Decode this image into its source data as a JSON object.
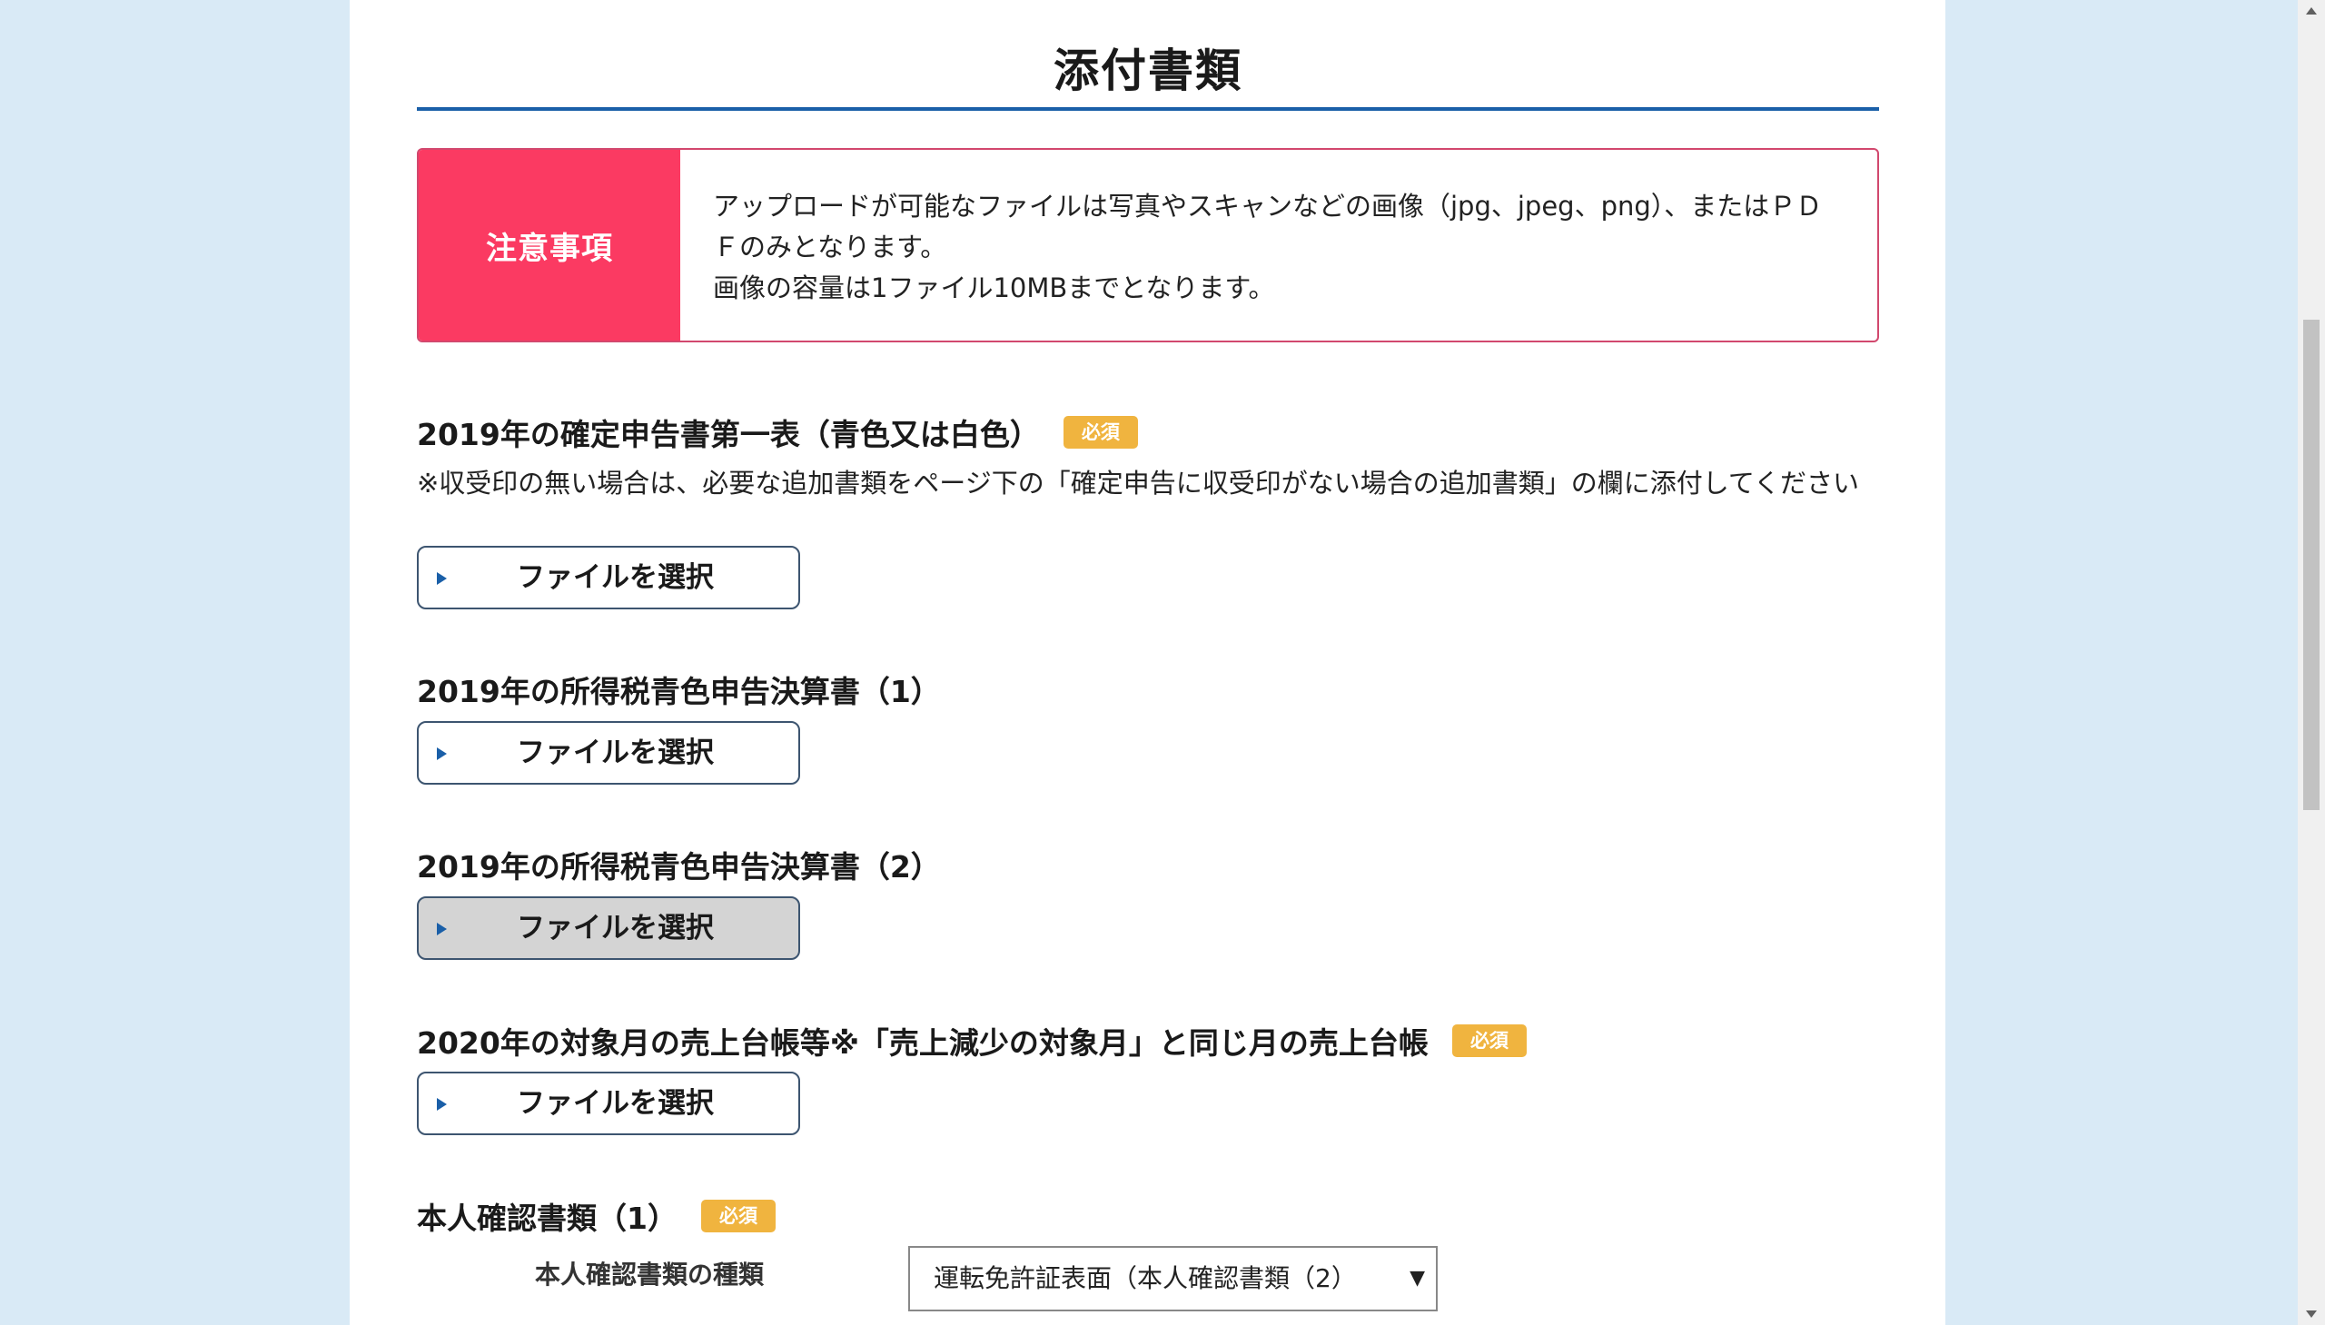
{
  "page_title": "添付書類",
  "notice": {
    "label": "注意事項",
    "line1": "アップロードが可能なファイルは写真やスキャンなどの画像（jpg、jpeg、png）、またはＰＤＦのみとなります。",
    "line2": "画像の容量は1ファイル10MBまでとなります。"
  },
  "required_badge": "必須",
  "file_button_label": "ファイルを選択",
  "sections": [
    {
      "title": "2019年の確定申告書第一表（青色又は白色）",
      "required": true,
      "note": "※収受印の無い場合は、必要な追加書類をページ下の「確定申告に収受印がない場合の追加書類」の欄に添付してください"
    },
    {
      "title": "2019年の所得税青色申告決算書（1）",
      "required": false
    },
    {
      "title": "2019年の所得税青色申告決算書（2）",
      "required": false
    },
    {
      "title": "2020年の対象月の売上台帳等※「売上減少の対象月」と同じ月の売上台帳",
      "required": true
    },
    {
      "title": "本人確認書類（1）",
      "required": true
    }
  ],
  "id_doc": {
    "field_label": "本人確認書類の種類",
    "selected": "運転免許証表面（本人確認書類（2）"
  },
  "colors": {
    "background": "#d9eaf6",
    "title_rule": "#1a5fa8",
    "notice_accent": "#fb3a62",
    "badge": "#f0b43f"
  }
}
